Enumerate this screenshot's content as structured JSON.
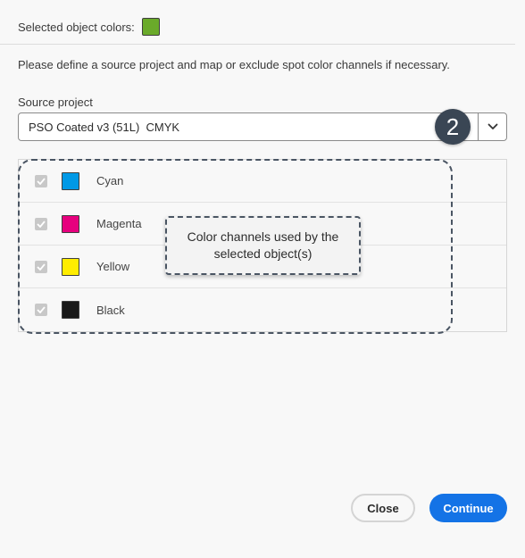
{
  "header": {
    "label": "Selected object colors:",
    "swatch_color": "#6aaa2a"
  },
  "instructions": "Please define a source project and map or exclude spot color channels if necessary.",
  "source_project": {
    "label": "Source project",
    "value": "PSO Coated v3 (51L)  CMYK",
    "dropdown_icon": "chevron-down-icon"
  },
  "callout": {
    "number": "2",
    "tooltip": "Color channels used by the selected object(s)"
  },
  "channels": [
    {
      "name": "Cyan",
      "color": "#0099e6",
      "checked": true
    },
    {
      "name": "Magenta",
      "color": "#e6007e",
      "checked": true
    },
    {
      "name": "Yellow",
      "color": "#ffed00",
      "checked": true
    },
    {
      "name": "Black",
      "color": "#1a1a1a",
      "checked": true
    }
  ],
  "footer": {
    "close_label": "Close",
    "continue_label": "Continue"
  }
}
